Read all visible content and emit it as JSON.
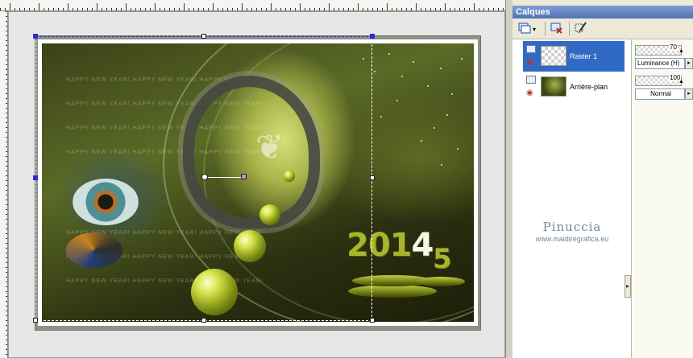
{
  "canvas": {
    "artwork": {
      "greeting_repeat": "HAPPY NEW YEAR! HAPPY NEW YEAR! HAPPY NEW YEAR!",
      "year_prefix": "201",
      "year_digit": "4",
      "year_alt_digit": "5"
    }
  },
  "panel": {
    "title": "Calques",
    "toolbar": {
      "new_layer_icon": "new-layer-icon",
      "delete_layer_icon": "delete-layer-icon",
      "edit_icon": "edit-brush-icon"
    },
    "layers": [
      {
        "name": "Raster 1",
        "selected": true,
        "thumbnail": "transparent",
        "opacity": "70",
        "blend_mode": "Luminance (H)"
      },
      {
        "name": "Arrière-plan",
        "selected": false,
        "thumbnail": "image",
        "opacity": "100",
        "blend_mode": "Normal"
      }
    ],
    "brand": {
      "name": "Pinuccia",
      "url": "www.maidiregrafica.eu"
    }
  },
  "colors": {
    "panel_title": "#4f72b8",
    "selected_layer": "#316ac5",
    "artwork_accent": "#a8b52c"
  }
}
